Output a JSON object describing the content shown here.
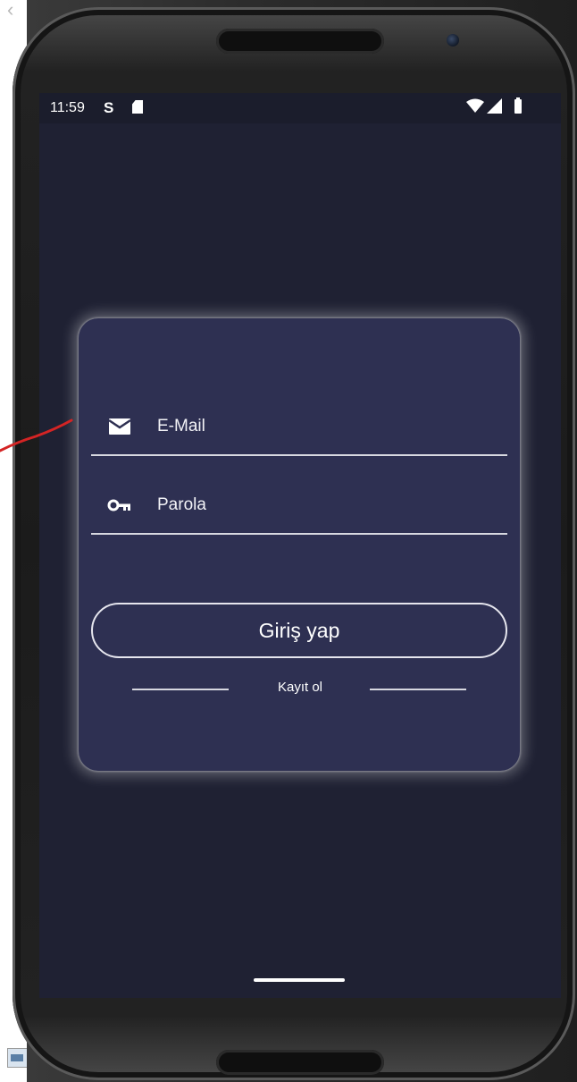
{
  "status_bar": {
    "time": "11:59",
    "carrier_glyph": "S",
    "icons": [
      "sd-card-icon",
      "wifi-icon",
      "signal-icon",
      "battery-icon"
    ]
  },
  "login": {
    "email_placeholder": "E-Mail",
    "password_placeholder": "Parola",
    "login_button": "Giriş yap",
    "register_link": "Kayıt ol"
  },
  "colors": {
    "screen_background": "#1f2133",
    "card_background": "#2e3052",
    "text": "#ffffff",
    "annotation_stroke": "#d42424"
  }
}
